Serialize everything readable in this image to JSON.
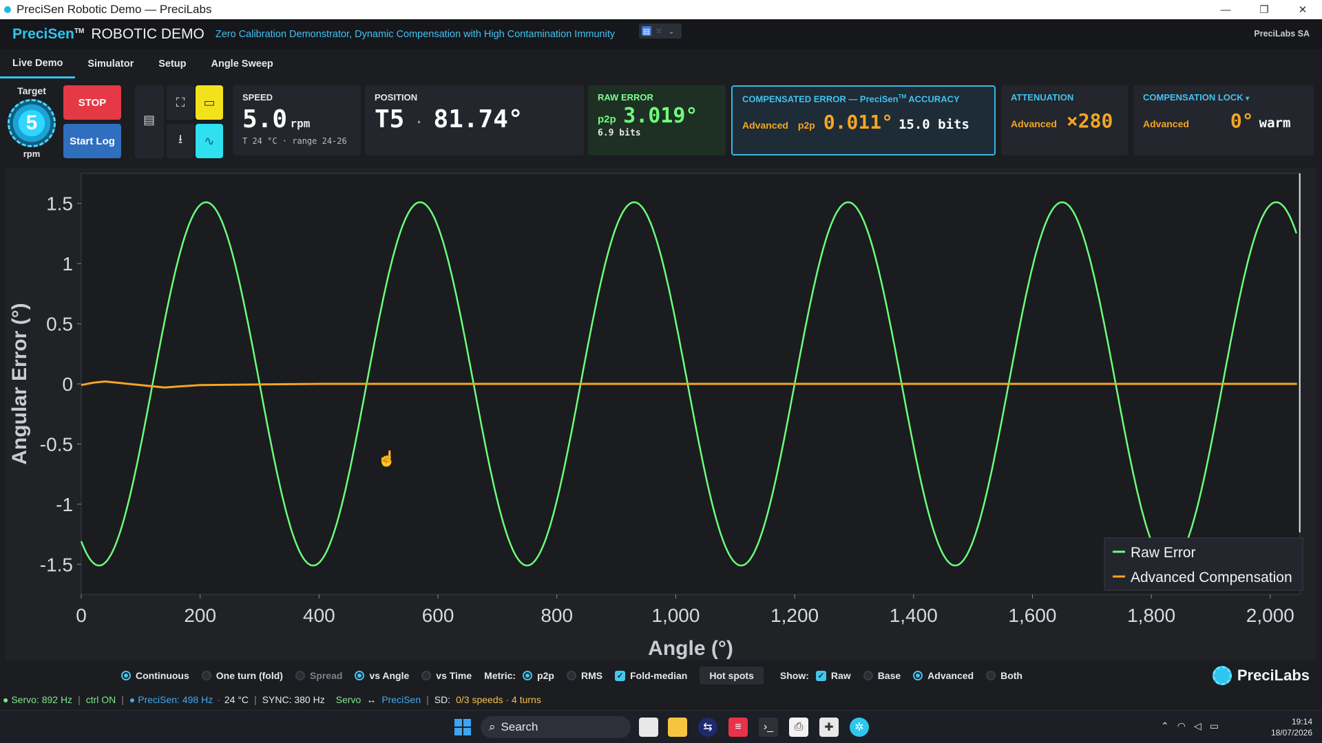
{
  "window": {
    "title": "PreciSen Robotic Demo — PreciLabs",
    "minimize": "—",
    "restore": "❐",
    "close": "✕"
  },
  "header": {
    "brand": "PreciSen",
    "brand_tm": "TM",
    "demo": "ROBOTIC DEMO",
    "subtitle": "Zero Calibration Demonstrator, Dynamic Compensation with High Contamination Immunity",
    "company": "PreciLabs SA"
  },
  "tabs": [
    {
      "label": "Live Demo",
      "active": true
    },
    {
      "label": "Simulator"
    },
    {
      "label": "Setup"
    },
    {
      "label": "Angle Sweep"
    }
  ],
  "target": {
    "label": "Target",
    "value": "5",
    "unit": "rpm"
  },
  "buttons": {
    "stop": "STOP",
    "start_log": "Start Log"
  },
  "speed": {
    "title": "SPEED",
    "value": "5.0",
    "unit": "rpm",
    "sub": "T 24 °C · range 24-26"
  },
  "position": {
    "title": "POSITION",
    "turn": "T5",
    "dot": "·",
    "angle": "81.74°"
  },
  "raw_error": {
    "title": "RAW ERROR",
    "metric": "p2p",
    "value": "3.019°",
    "bits": "6.9 bits"
  },
  "compensated": {
    "title_a": "COMPENSATED ERROR — PreciSen",
    "title_tm": "TM",
    "title_b": " ACCURACY",
    "mode": "Advanced",
    "metric": "p2p",
    "value": "0.011°",
    "bits": "15.0 bits"
  },
  "attenuation": {
    "title": "ATTENUATION",
    "mode": "Advanced",
    "value": "×280"
  },
  "lock": {
    "title": "COMPENSATION LOCK",
    "caret": "▾",
    "mode": "Advanced",
    "value": "0°",
    "state": "warm"
  },
  "chart_data": {
    "type": "line",
    "xlabel": "Angle (°)",
    "ylabel": "Angular Error (°)",
    "xlim": [
      0,
      2050
    ],
    "ylim": [
      -1.75,
      1.75
    ],
    "xticks": [
      "0",
      "200",
      "400",
      "600",
      "800",
      "1,000",
      "1,200",
      "1,400",
      "1,600",
      "1,800",
      "2,000"
    ],
    "yticks": [
      "1.5",
      "1",
      "0.5",
      "0",
      "-0.5",
      "-1",
      "-1.5"
    ],
    "grid": false,
    "legend_position": "bottom-right",
    "series": [
      {
        "name": "Raw Error",
        "color": "#6dff7a",
        "kind": "sine",
        "amplitude": 1.51,
        "period": 360,
        "phase_peak_x": 210,
        "x": [
          0,
          30,
          120,
          210,
          300,
          390,
          480,
          570,
          660,
          750,
          840,
          930,
          1020,
          1110,
          1200,
          1290,
          1380,
          1470,
          1560,
          1650,
          1740,
          1830,
          1920,
          2010,
          2045
        ],
        "y": [
          -1.4,
          -1.51,
          0,
          1.51,
          0,
          -1.51,
          0,
          1.51,
          0,
          -1.51,
          0,
          1.51,
          0,
          -1.51,
          0,
          1.51,
          0,
          -1.51,
          0,
          1.51,
          0,
          -1.51,
          0,
          1.51,
          1.17
        ]
      },
      {
        "name": "Advanced Compensation",
        "color": "#f5a623",
        "x": [
          0,
          20,
          40,
          80,
          140,
          200,
          400,
          800,
          1200,
          1600,
          2045
        ],
        "y": [
          -0.01,
          0.01,
          0.02,
          0.0,
          -0.03,
          -0.01,
          0.0,
          0.0,
          0.0,
          0.0,
          0.0
        ]
      }
    ]
  },
  "options": {
    "continuous": "Continuous",
    "one_turn": "One turn (fold)",
    "spread": "Spread",
    "vs_angle": "vs Angle",
    "vs_time": "vs Time",
    "metric_label": "Metric:",
    "p2p": "p2p",
    "rms": "RMS",
    "fold_median": "Fold-median",
    "hot_spots": "Hot spots",
    "show_label": "Show:",
    "raw": "Raw",
    "base": "Base",
    "advanced": "Advanced",
    "both": "Both"
  },
  "logo": "PreciLabs",
  "status": {
    "servo": "● Servo: 892 Hz",
    "ctrl": "ctrl ON",
    "precisen": "● PreciSen: 498 Hz",
    "temp": "24 °C",
    "sync": "SYNC: 380 Hz",
    "servo2": "Servo",
    "arrow": "↔",
    "precisen2": "PreciSen",
    "sd_label": "SD:",
    "sd_value": "0/3 speeds · 4 turns"
  },
  "taskbar": {
    "search": "Search",
    "time": "19:14",
    "date": "18/07/2026"
  }
}
